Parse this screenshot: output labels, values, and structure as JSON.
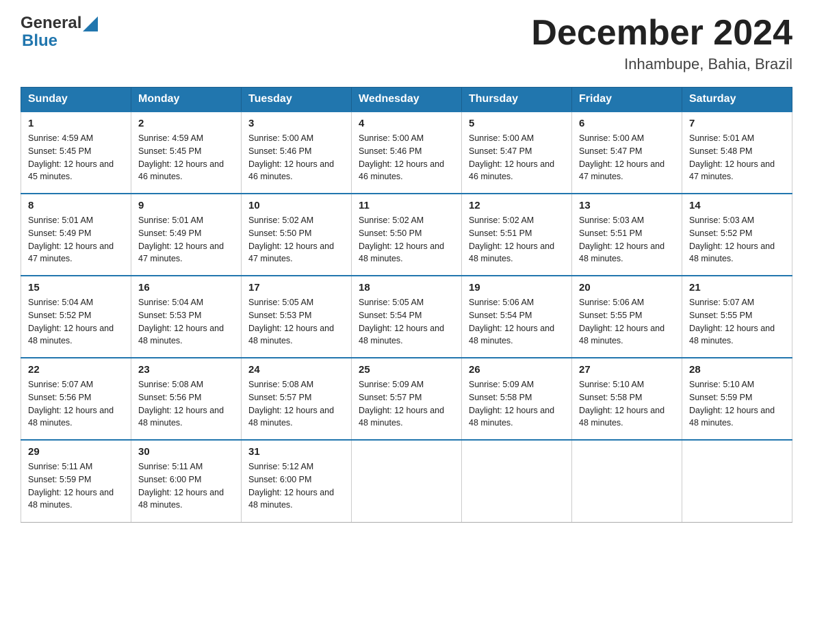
{
  "header": {
    "logo_general": "General",
    "logo_blue": "Blue",
    "month_title": "December 2024",
    "location": "Inhambupe, Bahia, Brazil"
  },
  "days_of_week": [
    "Sunday",
    "Monday",
    "Tuesday",
    "Wednesday",
    "Thursday",
    "Friday",
    "Saturday"
  ],
  "weeks": [
    [
      {
        "day": "1",
        "sunrise": "Sunrise: 4:59 AM",
        "sunset": "Sunset: 5:45 PM",
        "daylight": "Daylight: 12 hours and 45 minutes."
      },
      {
        "day": "2",
        "sunrise": "Sunrise: 4:59 AM",
        "sunset": "Sunset: 5:45 PM",
        "daylight": "Daylight: 12 hours and 46 minutes."
      },
      {
        "day": "3",
        "sunrise": "Sunrise: 5:00 AM",
        "sunset": "Sunset: 5:46 PM",
        "daylight": "Daylight: 12 hours and 46 minutes."
      },
      {
        "day": "4",
        "sunrise": "Sunrise: 5:00 AM",
        "sunset": "Sunset: 5:46 PM",
        "daylight": "Daylight: 12 hours and 46 minutes."
      },
      {
        "day": "5",
        "sunrise": "Sunrise: 5:00 AM",
        "sunset": "Sunset: 5:47 PM",
        "daylight": "Daylight: 12 hours and 46 minutes."
      },
      {
        "day": "6",
        "sunrise": "Sunrise: 5:00 AM",
        "sunset": "Sunset: 5:47 PM",
        "daylight": "Daylight: 12 hours and 47 minutes."
      },
      {
        "day": "7",
        "sunrise": "Sunrise: 5:01 AM",
        "sunset": "Sunset: 5:48 PM",
        "daylight": "Daylight: 12 hours and 47 minutes."
      }
    ],
    [
      {
        "day": "8",
        "sunrise": "Sunrise: 5:01 AM",
        "sunset": "Sunset: 5:49 PM",
        "daylight": "Daylight: 12 hours and 47 minutes."
      },
      {
        "day": "9",
        "sunrise": "Sunrise: 5:01 AM",
        "sunset": "Sunset: 5:49 PM",
        "daylight": "Daylight: 12 hours and 47 minutes."
      },
      {
        "day": "10",
        "sunrise": "Sunrise: 5:02 AM",
        "sunset": "Sunset: 5:50 PM",
        "daylight": "Daylight: 12 hours and 47 minutes."
      },
      {
        "day": "11",
        "sunrise": "Sunrise: 5:02 AM",
        "sunset": "Sunset: 5:50 PM",
        "daylight": "Daylight: 12 hours and 48 minutes."
      },
      {
        "day": "12",
        "sunrise": "Sunrise: 5:02 AM",
        "sunset": "Sunset: 5:51 PM",
        "daylight": "Daylight: 12 hours and 48 minutes."
      },
      {
        "day": "13",
        "sunrise": "Sunrise: 5:03 AM",
        "sunset": "Sunset: 5:51 PM",
        "daylight": "Daylight: 12 hours and 48 minutes."
      },
      {
        "day": "14",
        "sunrise": "Sunrise: 5:03 AM",
        "sunset": "Sunset: 5:52 PM",
        "daylight": "Daylight: 12 hours and 48 minutes."
      }
    ],
    [
      {
        "day": "15",
        "sunrise": "Sunrise: 5:04 AM",
        "sunset": "Sunset: 5:52 PM",
        "daylight": "Daylight: 12 hours and 48 minutes."
      },
      {
        "day": "16",
        "sunrise": "Sunrise: 5:04 AM",
        "sunset": "Sunset: 5:53 PM",
        "daylight": "Daylight: 12 hours and 48 minutes."
      },
      {
        "day": "17",
        "sunrise": "Sunrise: 5:05 AM",
        "sunset": "Sunset: 5:53 PM",
        "daylight": "Daylight: 12 hours and 48 minutes."
      },
      {
        "day": "18",
        "sunrise": "Sunrise: 5:05 AM",
        "sunset": "Sunset: 5:54 PM",
        "daylight": "Daylight: 12 hours and 48 minutes."
      },
      {
        "day": "19",
        "sunrise": "Sunrise: 5:06 AM",
        "sunset": "Sunset: 5:54 PM",
        "daylight": "Daylight: 12 hours and 48 minutes."
      },
      {
        "day": "20",
        "sunrise": "Sunrise: 5:06 AM",
        "sunset": "Sunset: 5:55 PM",
        "daylight": "Daylight: 12 hours and 48 minutes."
      },
      {
        "day": "21",
        "sunrise": "Sunrise: 5:07 AM",
        "sunset": "Sunset: 5:55 PM",
        "daylight": "Daylight: 12 hours and 48 minutes."
      }
    ],
    [
      {
        "day": "22",
        "sunrise": "Sunrise: 5:07 AM",
        "sunset": "Sunset: 5:56 PM",
        "daylight": "Daylight: 12 hours and 48 minutes."
      },
      {
        "day": "23",
        "sunrise": "Sunrise: 5:08 AM",
        "sunset": "Sunset: 5:56 PM",
        "daylight": "Daylight: 12 hours and 48 minutes."
      },
      {
        "day": "24",
        "sunrise": "Sunrise: 5:08 AM",
        "sunset": "Sunset: 5:57 PM",
        "daylight": "Daylight: 12 hours and 48 minutes."
      },
      {
        "day": "25",
        "sunrise": "Sunrise: 5:09 AM",
        "sunset": "Sunset: 5:57 PM",
        "daylight": "Daylight: 12 hours and 48 minutes."
      },
      {
        "day": "26",
        "sunrise": "Sunrise: 5:09 AM",
        "sunset": "Sunset: 5:58 PM",
        "daylight": "Daylight: 12 hours and 48 minutes."
      },
      {
        "day": "27",
        "sunrise": "Sunrise: 5:10 AM",
        "sunset": "Sunset: 5:58 PM",
        "daylight": "Daylight: 12 hours and 48 minutes."
      },
      {
        "day": "28",
        "sunrise": "Sunrise: 5:10 AM",
        "sunset": "Sunset: 5:59 PM",
        "daylight": "Daylight: 12 hours and 48 minutes."
      }
    ],
    [
      {
        "day": "29",
        "sunrise": "Sunrise: 5:11 AM",
        "sunset": "Sunset: 5:59 PM",
        "daylight": "Daylight: 12 hours and 48 minutes."
      },
      {
        "day": "30",
        "sunrise": "Sunrise: 5:11 AM",
        "sunset": "Sunset: 6:00 PM",
        "daylight": "Daylight: 12 hours and 48 minutes."
      },
      {
        "day": "31",
        "sunrise": "Sunrise: 5:12 AM",
        "sunset": "Sunset: 6:00 PM",
        "daylight": "Daylight: 12 hours and 48 minutes."
      },
      null,
      null,
      null,
      null
    ]
  ]
}
